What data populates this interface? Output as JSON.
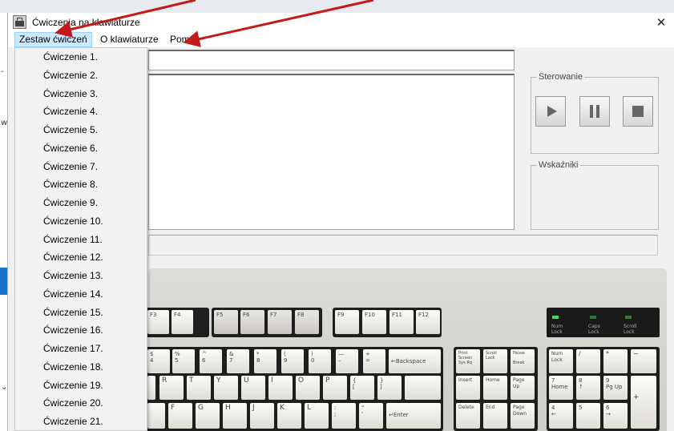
{
  "window": {
    "title": "Ćwiczenia na klawiaturze",
    "close_glyph": "✕"
  },
  "menu": [
    {
      "label": "Zestaw ćwiczeń"
    },
    {
      "label": "O klawiaturze"
    },
    {
      "label": "Pomoc"
    }
  ],
  "dropdown": {
    "items": [
      "Ćwiczenie 1.",
      "Ćwiczenie 2.",
      "Ćwiczenie 3.",
      "Ćwiczenie 4.",
      "Ćwiczenie 5.",
      "Ćwiczenie 6.",
      "Ćwiczenie 7.",
      "Ćwiczenie 8.",
      "Ćwiczenie 9.",
      "Ćwiczenie 10.",
      "Ćwiczenie 11.",
      "Ćwiczenie 12.",
      "Ćwiczenie 13.",
      "Ćwiczenie 14.",
      "Ćwiczenie 15.",
      "Ćwiczenie 16.",
      "Ćwiczenie 17.",
      "Ćwiczenie 18.",
      "Ćwiczenie 19.",
      "Ćwiczenie 20.",
      "Ćwiczenie 21."
    ]
  },
  "controls": {
    "group_label": "Sterowanie",
    "play_icon": "play-icon",
    "pause_icon": "pause-icon",
    "stop_icon": "stop-icon"
  },
  "indicators": {
    "group_label": "Wskaźniki"
  },
  "left_edge": {
    "glyph_top": "-",
    "glyph_mid": "w",
    "glyph_low": "⌄"
  },
  "keyboard": {
    "fkeys_a": [
      "F3",
      "F4"
    ],
    "fkeys_b": [
      "F5",
      "F6",
      "F7",
      "F8"
    ],
    "fkeys_c": [
      "F9",
      "F10",
      "F11",
      "F12"
    ],
    "num_row": [
      {
        "top": "$",
        "bot": "4"
      },
      {
        "top": "%",
        "bot": "5"
      },
      {
        "top": "^",
        "bot": "6"
      },
      {
        "top": "&",
        "bot": "7"
      },
      {
        "top": "*",
        "bot": "8"
      },
      {
        "top": "(",
        "bot": "9"
      },
      {
        "top": ")",
        "bot": "0"
      },
      {
        "top": "—",
        "bot": "–"
      },
      {
        "top": "+",
        "bot": "="
      }
    ],
    "backspace": "←Backspace",
    "top_row": [
      "R",
      "T",
      "Y",
      "U",
      "I",
      "O",
      "P"
    ],
    "top_row_brackets": [
      {
        "top": "{",
        "bot": "["
      },
      {
        "top": "}",
        "bot": "]"
      }
    ],
    "home_row": [
      "F",
      "G",
      "H",
      "J",
      "K",
      "L"
    ],
    "home_row_punct": [
      {
        "top": ":",
        "bot": ";"
      },
      {
        "top": "\"",
        "bot": "'"
      }
    ],
    "enter": "↵Enter",
    "nav_top": [
      "Print\nScreen\nSys Rq",
      "Scroll\nLock",
      "Pause\n\nBreak"
    ],
    "nav_mid": [
      "Insert",
      "Home",
      "Page\nUp"
    ],
    "nav_bot": [
      "Delete",
      "End",
      "Page\nDown"
    ],
    "num_pad_top": [
      "Num\nLock",
      "/",
      "*",
      "−"
    ],
    "num_pad_r1": [
      "7\nHome",
      "8\n↑",
      "9\nPg Up"
    ],
    "num_pad_plus": "+",
    "num_pad_r2": [
      "4\n←",
      "5\n",
      "6\n→"
    ],
    "leds": [
      {
        "label": "Num\nLock",
        "on": true
      },
      {
        "label": "Caps\nLock",
        "on": false
      },
      {
        "label": "Scroll\nLock",
        "on": false
      }
    ]
  },
  "colors": {
    "menu_highlight": "#cce8ff",
    "annotation_arrow": "#c41a1a",
    "left_accent": "#1a74c8"
  }
}
